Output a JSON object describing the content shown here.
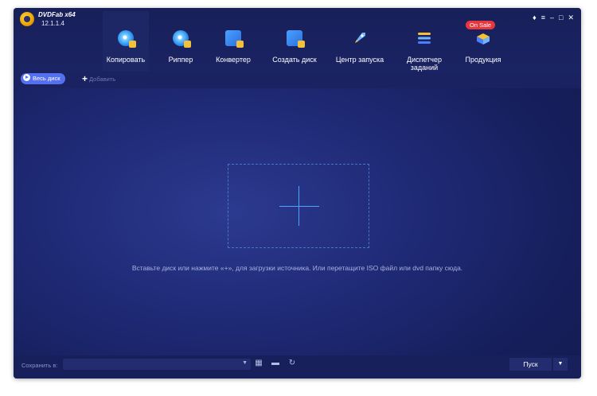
{
  "app": {
    "name": "DVDFab x64",
    "version": "12.1.1.4"
  },
  "nav": [
    {
      "label": "Копировать",
      "icon": "copy-disc-icon",
      "active": true
    },
    {
      "label": "Риппер",
      "icon": "ripper-disc-icon",
      "active": false
    },
    {
      "label": "Конвертер",
      "icon": "converter-film-icon",
      "active": false
    },
    {
      "label": "Создать диск",
      "icon": "creator-film-icon",
      "active": false
    },
    {
      "label": "Центр запуска",
      "icon": "rocket-icon",
      "active": false
    },
    {
      "label": "Диспетчер заданий",
      "icon": "task-stack-icon",
      "active": false
    },
    {
      "label": "Продукция",
      "icon": "product-box-icon",
      "active": false
    }
  ],
  "sale_badge": "On Sale",
  "toolbar": {
    "whole_disc": "Весь диск",
    "add": "Добавить"
  },
  "drop_hint": "Вставьте диск или нажмите «+», для загрузки источника. Или перетащите ISO файл или dvd папку сюда.",
  "bottom": {
    "save_to": "Сохранить в:",
    "save_path": "",
    "start": "Пуск"
  },
  "colors": {
    "accent": "#5470f0",
    "sale": "#e8363d",
    "background": "#1f2a76"
  }
}
